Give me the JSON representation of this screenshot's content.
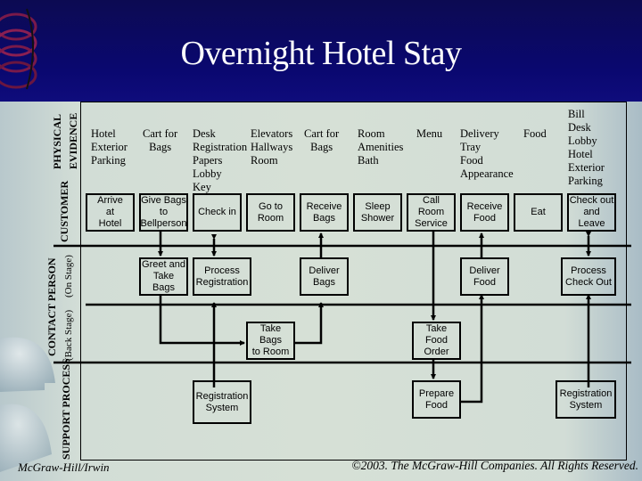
{
  "slide": {
    "title": "Overnight Hotel Stay",
    "footer_left": "McGraw-Hill/Irwin",
    "footer_right": "©2003. The McGraw-Hill Companies. All Rights Reserved."
  },
  "lanes": {
    "physical_evidence": "PHYSICAL",
    "physical_evidence_2": "EVIDENCE",
    "customer": "CUSTOMER",
    "contact_person": "CONTACT PERSON",
    "on_stage": "(On Stage)",
    "back_stage": "(Back Stage)",
    "support": "SUPPORT PROCESS"
  },
  "physical_evidence": [
    "Hotel\nExterior\nParking",
    "Cart for\nBags",
    "Desk\nRegistration\nPapers\nLobby\nKey",
    "Elevators\nHallways\nRoom",
    "Cart for\nBags",
    "Room\nAmenities\nBath",
    "Menu",
    "Delivery\nTray\nFood\nAppearance",
    "Food",
    "Bill\nDesk\nLobby\nHotel\nExterior\nParking"
  ],
  "customer_actions": [
    "Arrive\nat\nHotel",
    "Give Bags\nto\nBellperson",
    "Check in",
    "Go to\nRoom",
    "Receive\nBags",
    "Sleep\nShower",
    "Call\nRoom\nService",
    "Receive\nFood",
    "Eat",
    "Check out\nand\nLeave"
  ],
  "onstage_actions": [
    "Greet and\nTake\nBags",
    "Process\nRegistration",
    "Deliver\nBags",
    "Deliver\nFood",
    "Process\nCheck Out"
  ],
  "backstage_actions": [
    "Take Bags\nto Room",
    "Take\nFood\nOrder"
  ],
  "support_actions": [
    "Registration\nSystem",
    "Prepare\nFood",
    "Registration\nSystem"
  ]
}
